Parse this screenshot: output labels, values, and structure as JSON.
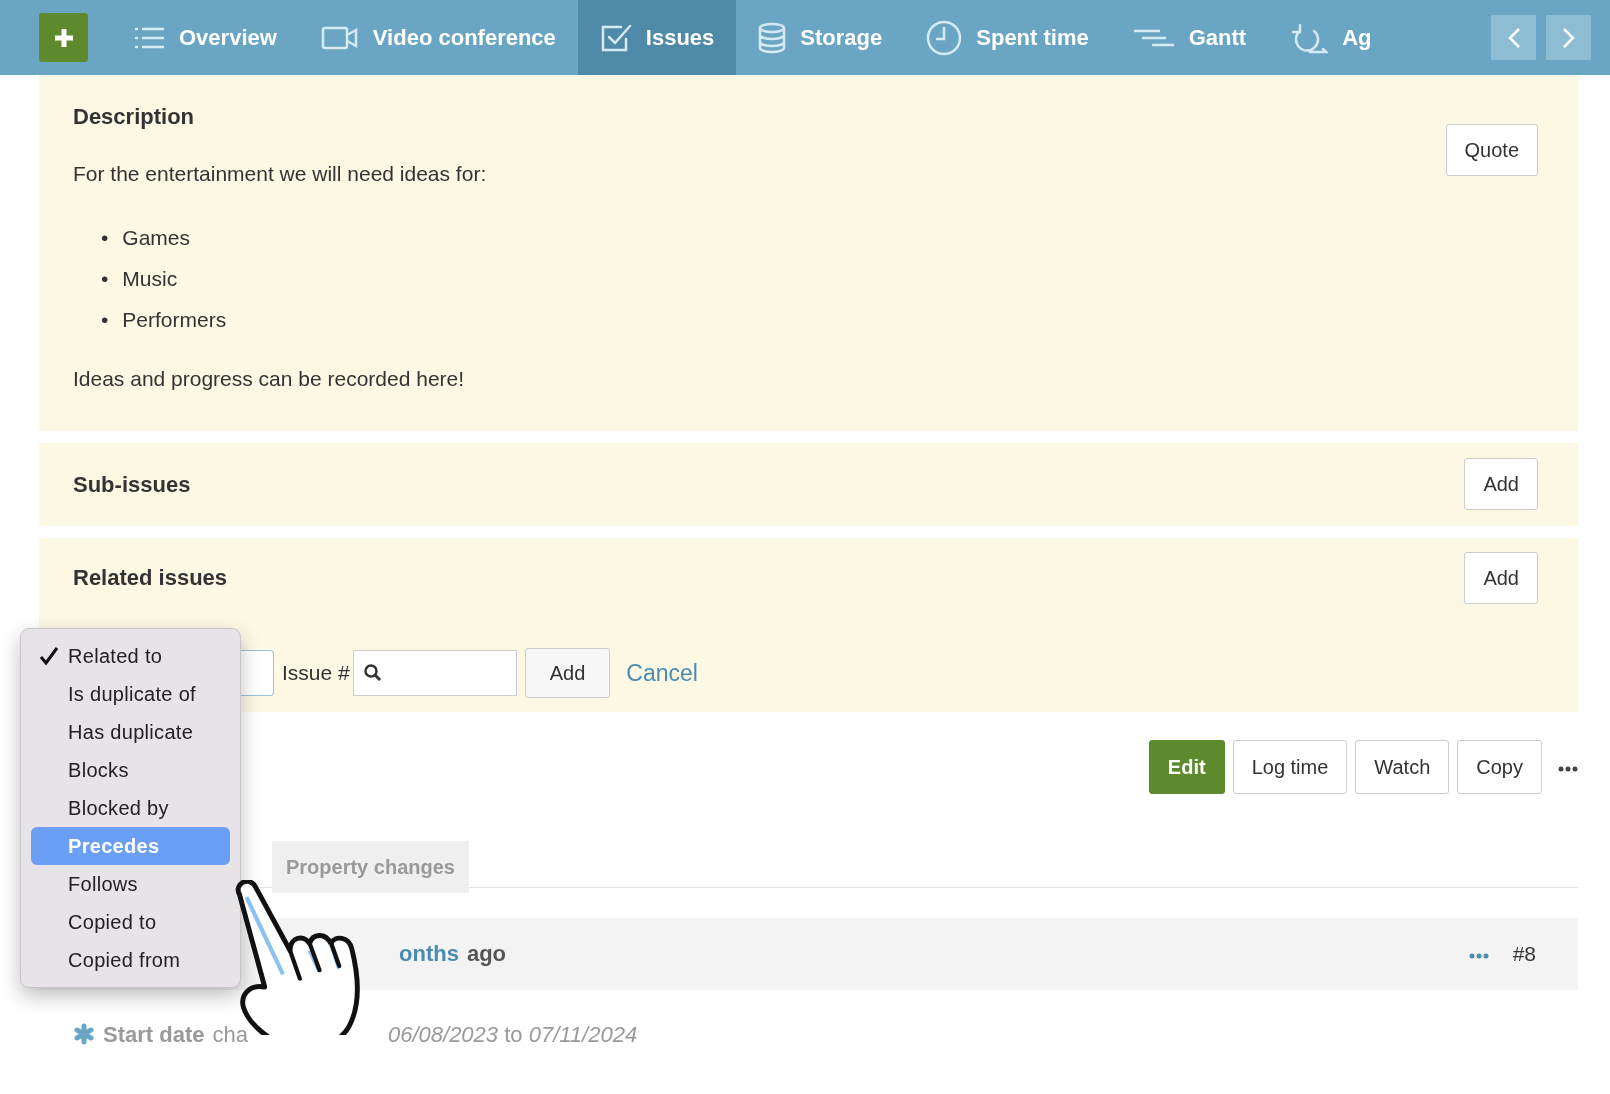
{
  "nav": {
    "items": [
      {
        "label": "Overview",
        "selected": false
      },
      {
        "label": "Video conference",
        "selected": false
      },
      {
        "label": "Issues",
        "selected": true
      },
      {
        "label": "Storage",
        "selected": false
      },
      {
        "label": "Spent time",
        "selected": false
      },
      {
        "label": "Gantt",
        "selected": false
      },
      {
        "label": "Ag",
        "selected": false
      }
    ]
  },
  "description": {
    "title": "Description",
    "quote_button": "Quote",
    "intro": "For the entertainment we will need ideas for:",
    "bullets": [
      {
        "marker": "•",
        "text": "Games"
      },
      {
        "marker": "•",
        "text": "Music"
      },
      {
        "marker": "•",
        "text": "Performers"
      }
    ],
    "closing": "Ideas and progress can be recorded here!"
  },
  "sub_issues": {
    "title": "Sub-issues",
    "add_button": "Add"
  },
  "related_issues": {
    "title": "Related issues",
    "add_button": "Add",
    "form": {
      "issue_label": "Issue #",
      "add_button": "Add",
      "cancel_link": "Cancel"
    },
    "relation_menu": [
      {
        "label": "Related to",
        "checked": true,
        "selected": false
      },
      {
        "label": "Is duplicate of",
        "checked": false,
        "selected": false
      },
      {
        "label": "Has duplicate",
        "checked": false,
        "selected": false
      },
      {
        "label": "Blocks",
        "checked": false,
        "selected": false
      },
      {
        "label": "Blocked by",
        "checked": false,
        "selected": false
      },
      {
        "label": "Precedes",
        "checked": false,
        "selected": true
      },
      {
        "label": "Follows",
        "checked": false,
        "selected": false
      },
      {
        "label": "Copied to",
        "checked": false,
        "selected": false
      },
      {
        "label": "Copied from",
        "checked": false,
        "selected": false
      }
    ]
  },
  "actions": [
    {
      "label": "Edit",
      "kind": "primary"
    },
    {
      "label": "Log time",
      "kind": "secondary"
    },
    {
      "label": "Watch",
      "kind": "secondary"
    },
    {
      "label": "Copy",
      "kind": "secondary"
    }
  ],
  "tabs": [
    {
      "label": "Property changes",
      "selected": false
    }
  ],
  "journal": {
    "time_link": "onths",
    "time_suffix": "ago",
    "number": "#8"
  },
  "change": {
    "field": "Start date",
    "fragment": "cha",
    "values": "*06/08/2023* to *07/11/2024*"
  }
}
